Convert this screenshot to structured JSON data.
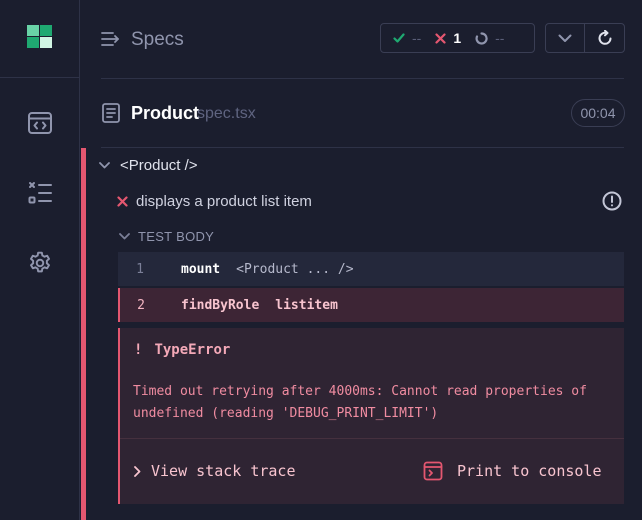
{
  "colors": {
    "background": "#1b1e2e",
    "fail": "#e45770",
    "pass": "#1fa971",
    "brand_light": "#69d3a7",
    "brand_dark": "#00814d"
  },
  "sidebar": {
    "logo": "cypress-logo",
    "items": [
      {
        "icon": "code-window-icon"
      },
      {
        "icon": "test-list-icon"
      },
      {
        "icon": "gear-icon"
      }
    ]
  },
  "header": {
    "icon": "specs-arrow-icon",
    "title": "Specs",
    "stats": {
      "passed": "--",
      "failed": "1",
      "pending": "--"
    },
    "controls": {
      "icons": [
        "chevron-down-icon",
        "rerun-icon"
      ]
    }
  },
  "spec_file": {
    "icon": "document-icon",
    "name": "Product",
    "extension": "spec.tsx",
    "duration": "00:04"
  },
  "suite": {
    "title": "<Product />",
    "test": {
      "title": "displays a product list item",
      "status": "failed",
      "body_label": "TEST BODY",
      "commands": [
        {
          "number": "1",
          "name": "mount",
          "arg": "<Product ... />"
        },
        {
          "number": "2",
          "name": "findByRole",
          "arg": "listitem"
        }
      ],
      "error": {
        "bang": "!",
        "type": "TypeError",
        "message": "Timed out retrying after 4000ms: Cannot read properties of undefined (reading 'DEBUG_PRINT_LIMIT')",
        "stack_label": "View stack trace",
        "print_label": "Print to console"
      }
    }
  }
}
